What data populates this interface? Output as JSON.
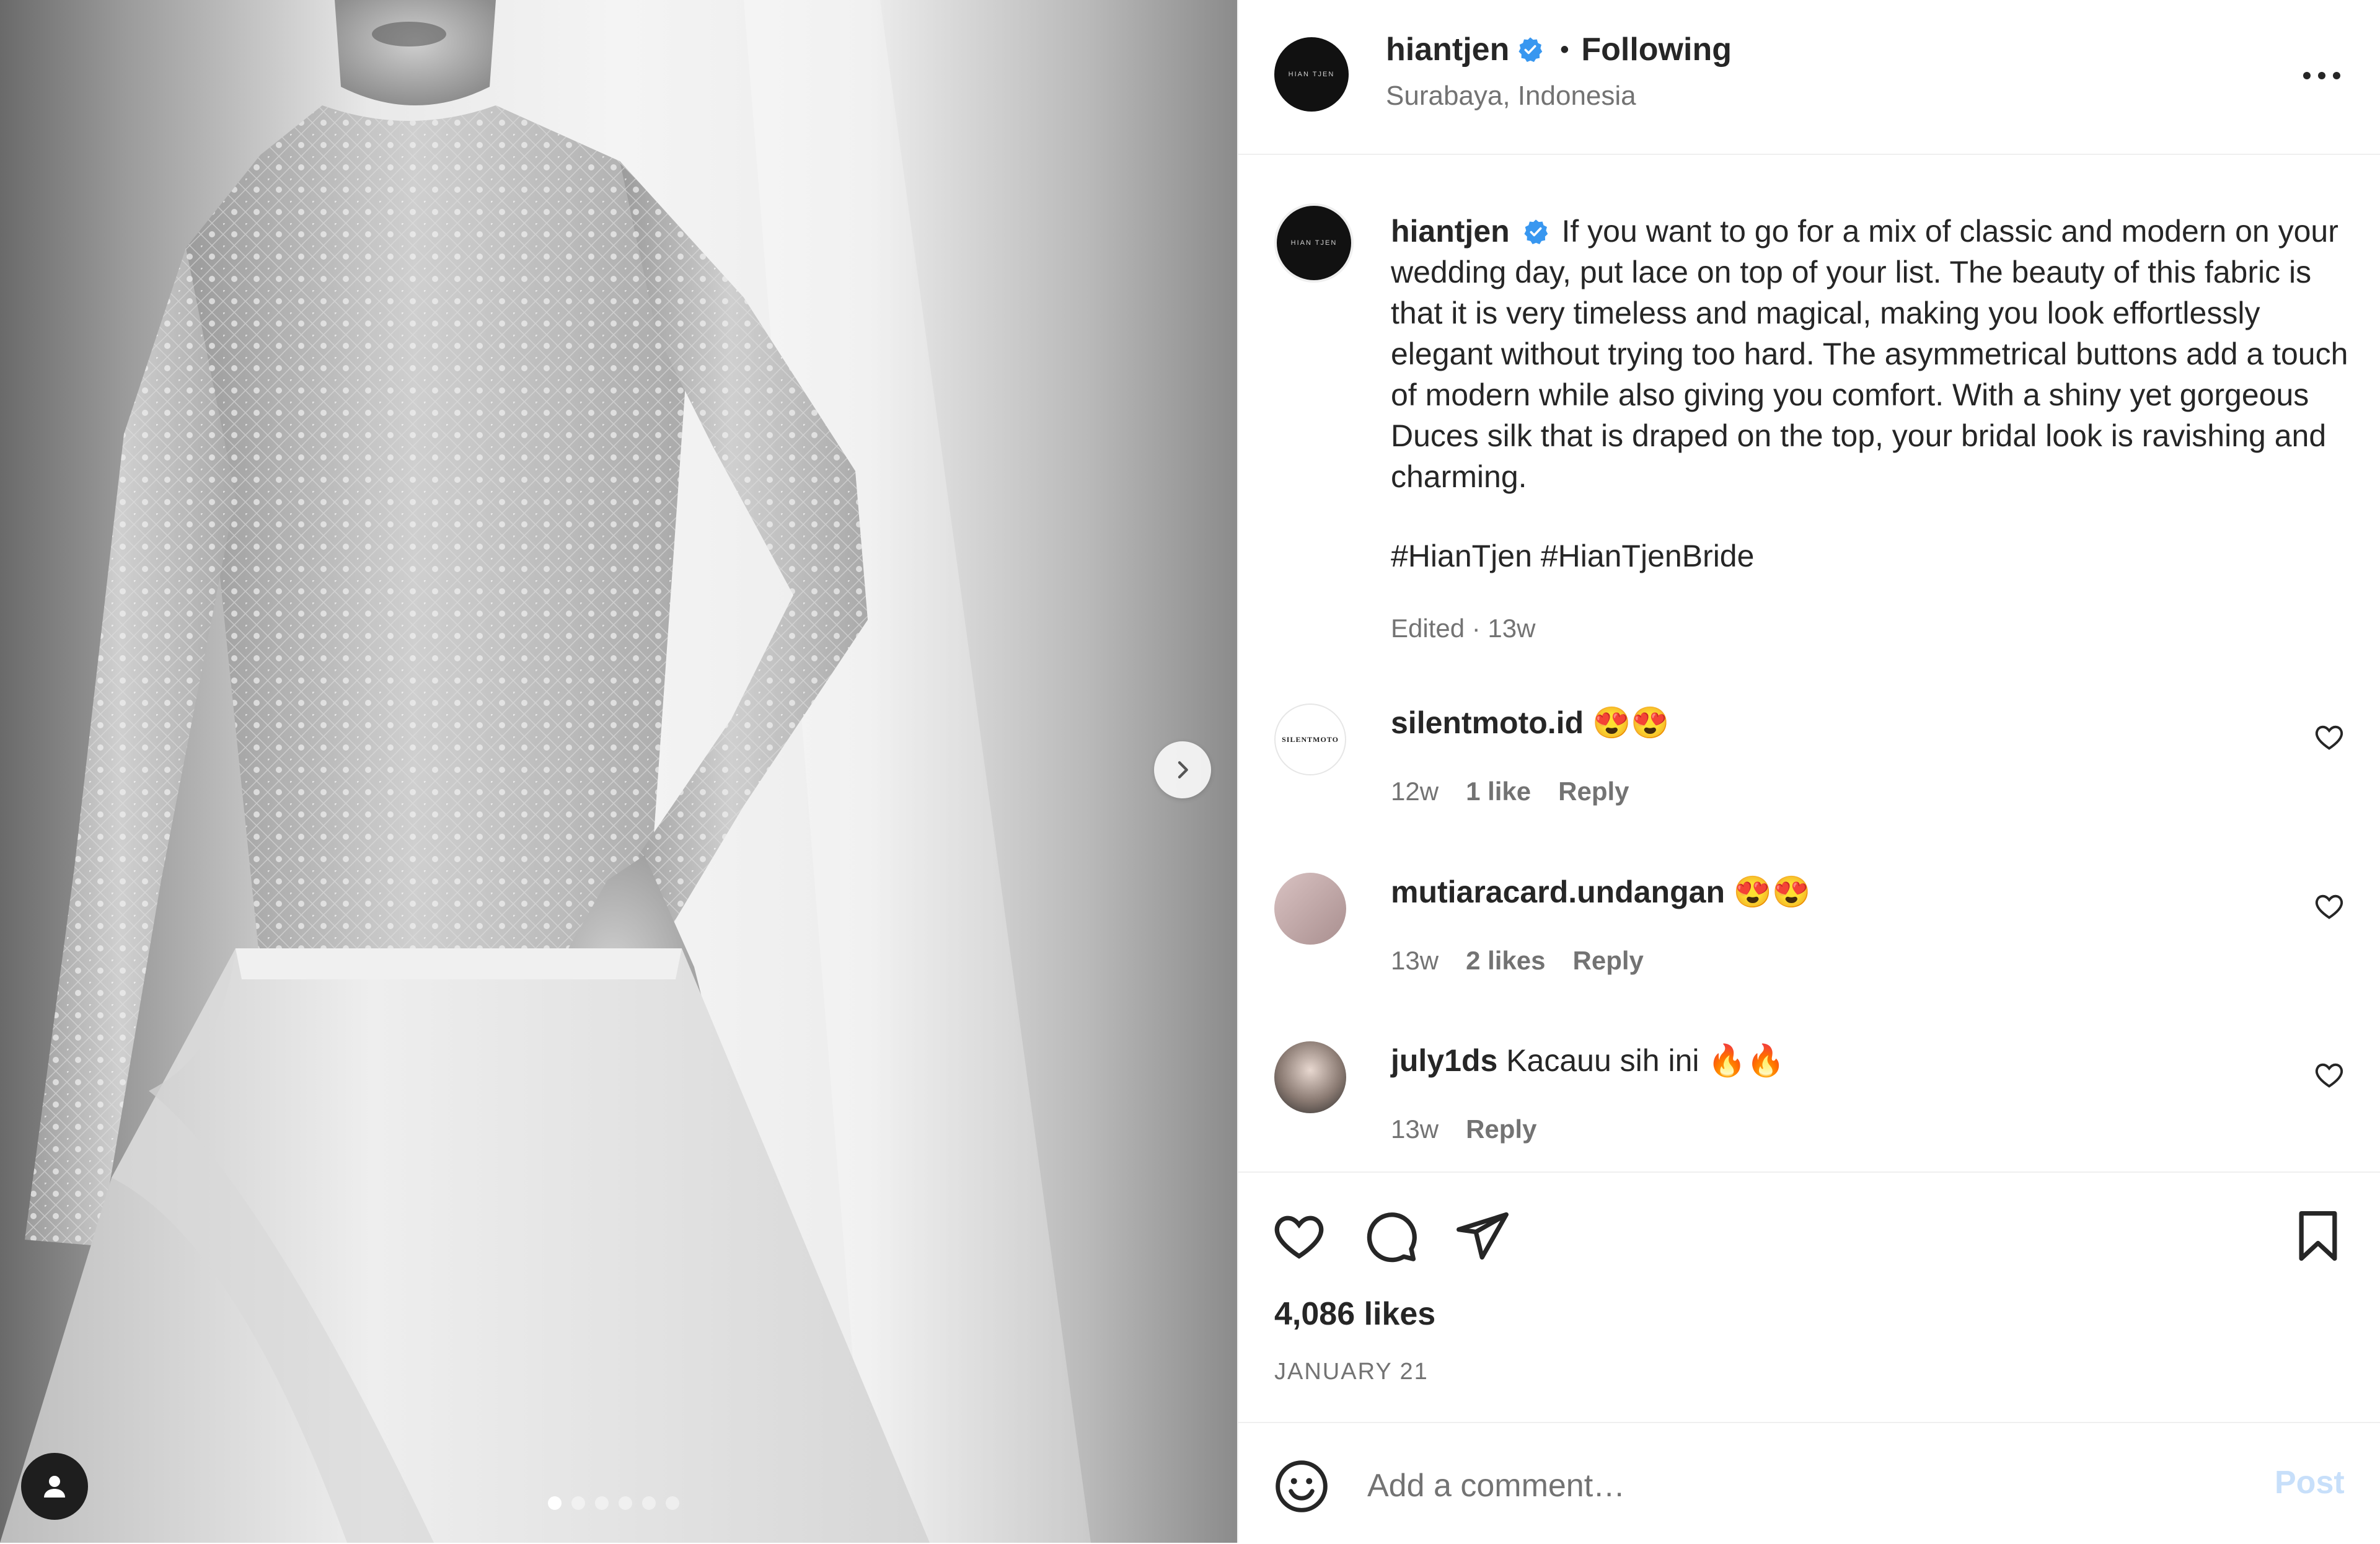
{
  "media": {
    "carousel_count": 6,
    "active_index": 0
  },
  "post_header": {
    "username": "hiantjen",
    "verified": true,
    "separator": "•",
    "follow_status": "Following",
    "location": "Surabaya, Indonesia",
    "avatar_logo_text": "HIAN TJEN"
  },
  "caption": {
    "username": "hiantjen",
    "text": "If you want to go for a mix of classic and modern on your wedding day, put lace on top of your list. The beauty of this fabric is that it is very timeless and magical, making you look effortlessly elegant without trying too hard. The asymmetrical buttons add a touch of modern while also giving you comfort. With a shiny yet gorgeous Duces silk that is draped on the top, your bridal look is ravishing and charming.",
    "hashtags": "#HianTjen #HianTjenBride",
    "meta": "Edited · 13w"
  },
  "comments": [
    {
      "username": "silentmoto.id",
      "text": "😍😍",
      "time": "12w",
      "likes": "1 like",
      "reply": "Reply",
      "avatar_text": "SILENTMOTO"
    },
    {
      "username": "mutiaracard.undangan",
      "text": "😍😍",
      "time": "13w",
      "likes": "2 likes",
      "reply": "Reply"
    },
    {
      "username": "july1ds",
      "text": "Kacauu sih ini 🔥🔥",
      "time": "13w",
      "likes": "",
      "reply": "Reply"
    }
  ],
  "actions": {
    "likes_count": "4,086 likes",
    "date": "JANUARY 21"
  },
  "add_comment": {
    "placeholder": "Add a comment…",
    "post_label": "Post"
  },
  "colors": {
    "text_primary": "#262626",
    "text_secondary": "#737373",
    "verified_blue": "#3897f0",
    "post_button_disabled": "#c7dffa",
    "divider": "#efefef"
  }
}
